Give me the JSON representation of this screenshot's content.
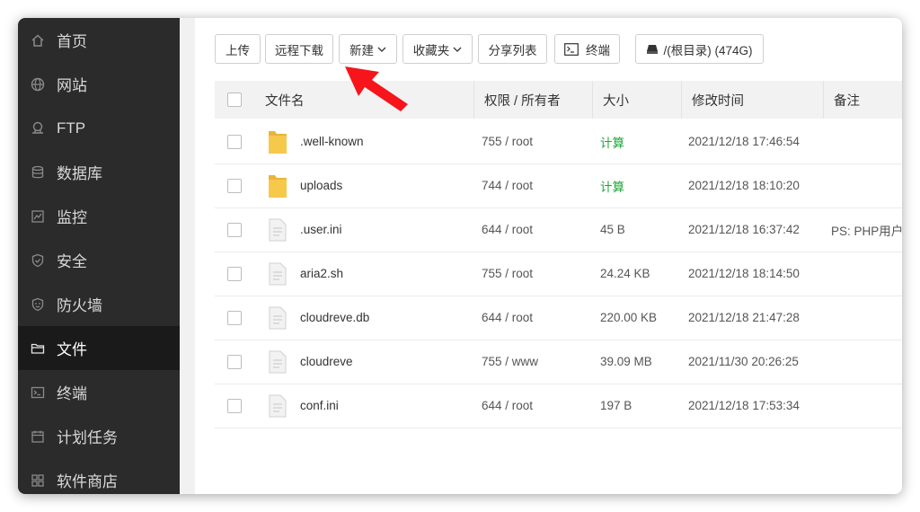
{
  "sidebar": {
    "items": [
      {
        "label": "首页",
        "icon": "home-icon",
        "active": false
      },
      {
        "label": "网站",
        "icon": "globe-icon",
        "active": false
      },
      {
        "label": "FTP",
        "icon": "ftp-icon",
        "active": false
      },
      {
        "label": "数据库",
        "icon": "database-icon",
        "active": false
      },
      {
        "label": "监控",
        "icon": "monitor-icon",
        "active": false
      },
      {
        "label": "安全",
        "icon": "shield-icon",
        "active": false
      },
      {
        "label": "防火墙",
        "icon": "firewall-icon",
        "active": false
      },
      {
        "label": "文件",
        "icon": "folder-icon",
        "active": true
      },
      {
        "label": "终端",
        "icon": "terminal-icon",
        "active": false
      },
      {
        "label": "计划任务",
        "icon": "calendar-icon",
        "active": false
      },
      {
        "label": "软件商店",
        "icon": "grid-icon",
        "active": false
      }
    ]
  },
  "toolbar": {
    "upload": "上传",
    "remote_download": "远程下载",
    "new": "新建",
    "favorites": "收藏夹",
    "share_list": "分享列表",
    "terminal": "终端",
    "disk": "/(根目录) (474G)"
  },
  "table": {
    "headers": {
      "name": "文件名",
      "permission": "权限 / 所有者",
      "size": "大小",
      "modified": "修改时间",
      "remark": "备注"
    },
    "rows": [
      {
        "type": "folder",
        "name": ".well-known",
        "perm": "755 / root",
        "size": "计算",
        "modified": "2021/12/18 17:46:54",
        "remark": ""
      },
      {
        "type": "folder",
        "name": "uploads",
        "perm": "744 / root",
        "size": "计算",
        "modified": "2021/12/18 18:10:20",
        "remark": ""
      },
      {
        "type": "file",
        "name": ".user.ini",
        "perm": "644 / root",
        "size": "45 B",
        "modified": "2021/12/18 16:37:42",
        "remark": "PS: PHP用户配"
      },
      {
        "type": "file",
        "name": "aria2.sh",
        "perm": "755 / root",
        "size": "24.24 KB",
        "modified": "2021/12/18 18:14:50",
        "remark": ""
      },
      {
        "type": "file",
        "name": "cloudreve.db",
        "perm": "644 / root",
        "size": "220.00 KB",
        "modified": "2021/12/18 21:47:28",
        "remark": ""
      },
      {
        "type": "file",
        "name": "cloudreve",
        "perm": "755 / www",
        "size": "39.09 MB",
        "modified": "2021/11/30 20:26:25",
        "remark": ""
      },
      {
        "type": "file",
        "name": "conf.ini",
        "perm": "644 / root",
        "size": "197 B",
        "modified": "2021/12/18 17:53:34",
        "remark": ""
      }
    ]
  },
  "colors": {
    "sidebar_bg": "#2b2b2b",
    "sidebar_active_bg": "#1a1a1a",
    "accent_green": "#20a53a",
    "arrow_red": "#f5151b",
    "folder_yellow": "#f7c94a"
  }
}
